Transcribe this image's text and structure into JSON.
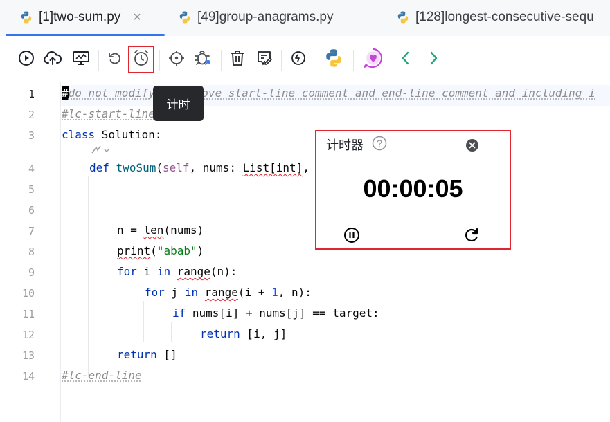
{
  "tabs": [
    {
      "label": "[1]two-sum.py",
      "active": true,
      "close": "×"
    },
    {
      "label": "[49]group-anagrams.py",
      "active": false
    },
    {
      "label": "[128]longest-consecutive-sequ",
      "active": false
    }
  ],
  "toolbar": {
    "buttons": [
      "run-icon",
      "upload-icon",
      "monitor-icon",
      "undo-icon",
      "timer-icon",
      "crosshair-icon",
      "debug-icon",
      "trash-icon",
      "edit-note-icon",
      "history-icon",
      "python-icon",
      "heart-chat-icon",
      "chevron-left-icon",
      "chevron-right-icon"
    ]
  },
  "tooltip": {
    "text": "计时"
  },
  "editor": {
    "line_numbers": [
      "1",
      "2",
      "3",
      "4",
      "5",
      "6",
      "7",
      "8",
      "9",
      "10",
      "11",
      "12",
      "13",
      "14"
    ],
    "lines": {
      "l1_cursor": "#",
      "l1_rest": "do not modify or remove start-line comment and end-line comment and including i",
      "l2": "#lc-start-line",
      "l3_kw": "class",
      "l3_name": " Solution:",
      "l4_kw": "def",
      "l4_fn": "twoSum",
      "l4_self": "self",
      "l4_rest": ", nums: ",
      "l4_type": "List[int]",
      "l4_end": ",",
      "l7_a": "n = ",
      "l7_len": "len",
      "l7_b": "(nums)",
      "l8_print": "print",
      "l8_a": "(",
      "l8_str": "\"abab\"",
      "l8_b": ")",
      "l9_for": "for",
      "l9_a": " i ",
      "l9_in": "in",
      "l9_sp": " ",
      "l9_range": "range",
      "l9_b": "(n):",
      "l10_for": "for",
      "l10_a": " j ",
      "l10_in": "in",
      "l10_sp": " ",
      "l10_range": "range",
      "l10_b": "(i + ",
      "l10_num": "1",
      "l10_c": ", n):",
      "l11_if": "if",
      "l11_rest": " nums[i] + nums[j] == target:",
      "l12_return": "return",
      "l12_rest": " [i, j]",
      "l13_return": "return",
      "l13_rest": " []",
      "l14": "#lc-end-line"
    }
  },
  "timer": {
    "title": "计时器",
    "help": "?",
    "value": "00:00:05"
  },
  "colors": {
    "accent": "#3574f0",
    "highlight": "#e0262f",
    "keyword": "#0033b3",
    "function": "#00627a",
    "string": "#067d17"
  }
}
